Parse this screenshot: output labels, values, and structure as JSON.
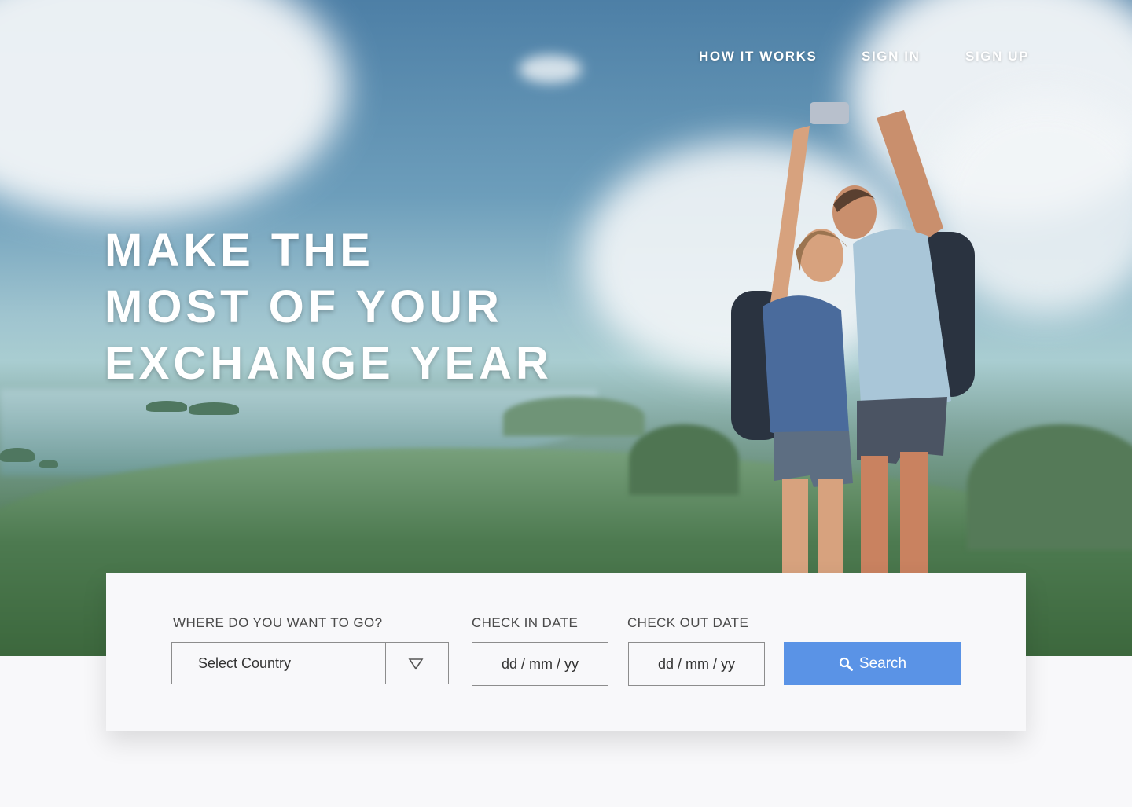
{
  "nav": {
    "links": [
      "HOW IT WORKS",
      "SIGN IN",
      "SIGN UP"
    ]
  },
  "hero": {
    "headline": [
      "MAKE THE",
      "MOST OF YOUR",
      "EXCHANGE YEAR"
    ]
  },
  "search_form": {
    "destination_label": "WHERE DO YOU WANT TO GO?",
    "destination_value": "Select Country",
    "check_in_label": "CHECK IN DATE",
    "check_in_value": "dd / mm / yy",
    "check_out_label": "CHECK OUT DATE",
    "check_out_value": "dd / mm / yy",
    "search_label": "Search"
  },
  "icons": {
    "dropdown": "chevron-down-icon",
    "search": "search-icon"
  },
  "colors": {
    "accent": "#5a93e6",
    "page_background": "#f8f8fa",
    "text_dark": "#333333"
  }
}
